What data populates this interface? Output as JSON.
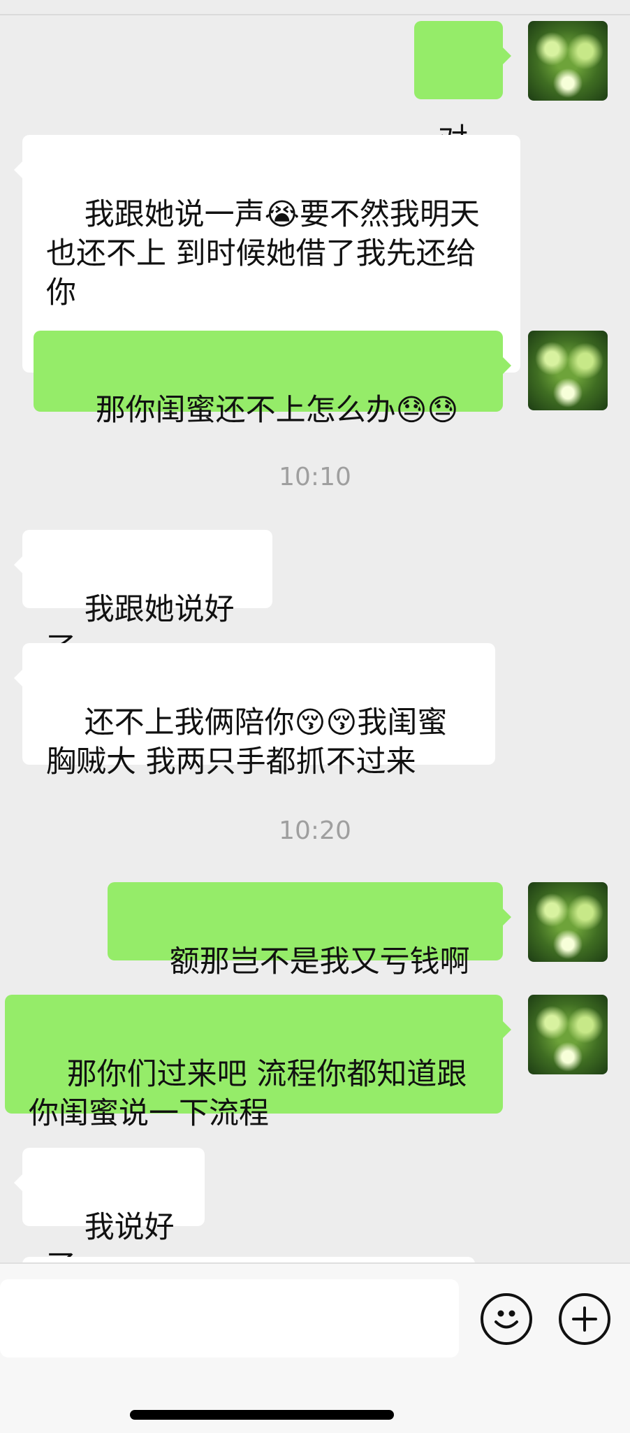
{
  "messages": [
    {
      "side": "right",
      "text": "对"
    },
    {
      "side": "left",
      "text": "我跟她说一声😭要不然我明天也还不上 到时候她借了我先还给你"
    },
    {
      "side": "right",
      "text": "那你闺蜜还不上怎么办😓😓"
    },
    {
      "side": "time",
      "text": "10:10"
    },
    {
      "side": "left",
      "text": "我跟她说好了"
    },
    {
      "side": "left",
      "text": "还不上我俩陪你😚😚我闺蜜胸贼大 我两只手都抓不过来"
    },
    {
      "side": "time",
      "text": "10:20"
    },
    {
      "side": "right",
      "text": "额那岂不是我又亏钱啊"
    },
    {
      "side": "right",
      "text": "那你们过来吧 流程你都知道跟你闺蜜说一下流程"
    },
    {
      "side": "left",
      "text": "我说好了"
    }
  ],
  "composer": {
    "placeholder": ""
  },
  "icons": {
    "emoji": "emoji-icon",
    "add": "plus-icon"
  }
}
